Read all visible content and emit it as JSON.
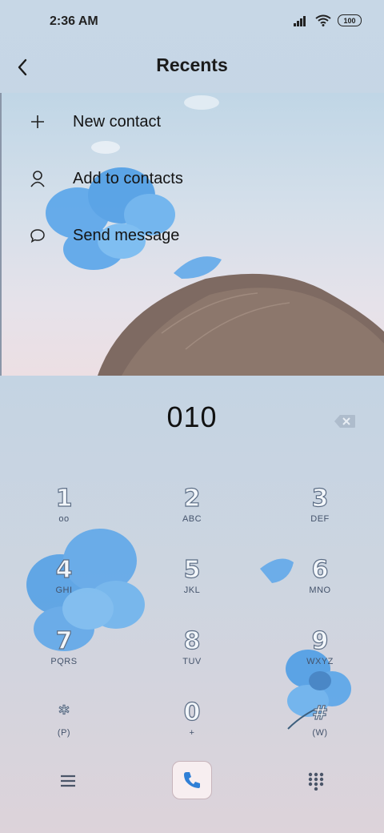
{
  "status_bar": {
    "time": "2:36 AM",
    "battery": "100"
  },
  "header": {
    "title": "Recents"
  },
  "menu": [
    {
      "icon": "plus-icon",
      "label": "New contact"
    },
    {
      "icon": "person-icon",
      "label": "Add to contacts"
    },
    {
      "icon": "chat-bubble-icon",
      "label": "Send message"
    }
  ],
  "dialer": {
    "number": "010",
    "keys": [
      {
        "digit": "1",
        "letters": "oo"
      },
      {
        "digit": "2",
        "letters": "ABC"
      },
      {
        "digit": "3",
        "letters": "DEF"
      },
      {
        "digit": "4",
        "letters": "GHI"
      },
      {
        "digit": "5",
        "letters": "JKL"
      },
      {
        "digit": "6",
        "letters": "MNO"
      },
      {
        "digit": "7",
        "letters": "PQRS"
      },
      {
        "digit": "8",
        "letters": "TUV"
      },
      {
        "digit": "9",
        "letters": "WXYZ"
      },
      {
        "digit": "*",
        "letters": "(P)"
      },
      {
        "digit": "0",
        "letters": "+"
      },
      {
        "digit": "#",
        "letters": "(W)"
      }
    ]
  },
  "colors": {
    "accent": "#2f7fd6",
    "call_button_bg": "#f7eef0",
    "flower": "#4f9ee6"
  }
}
